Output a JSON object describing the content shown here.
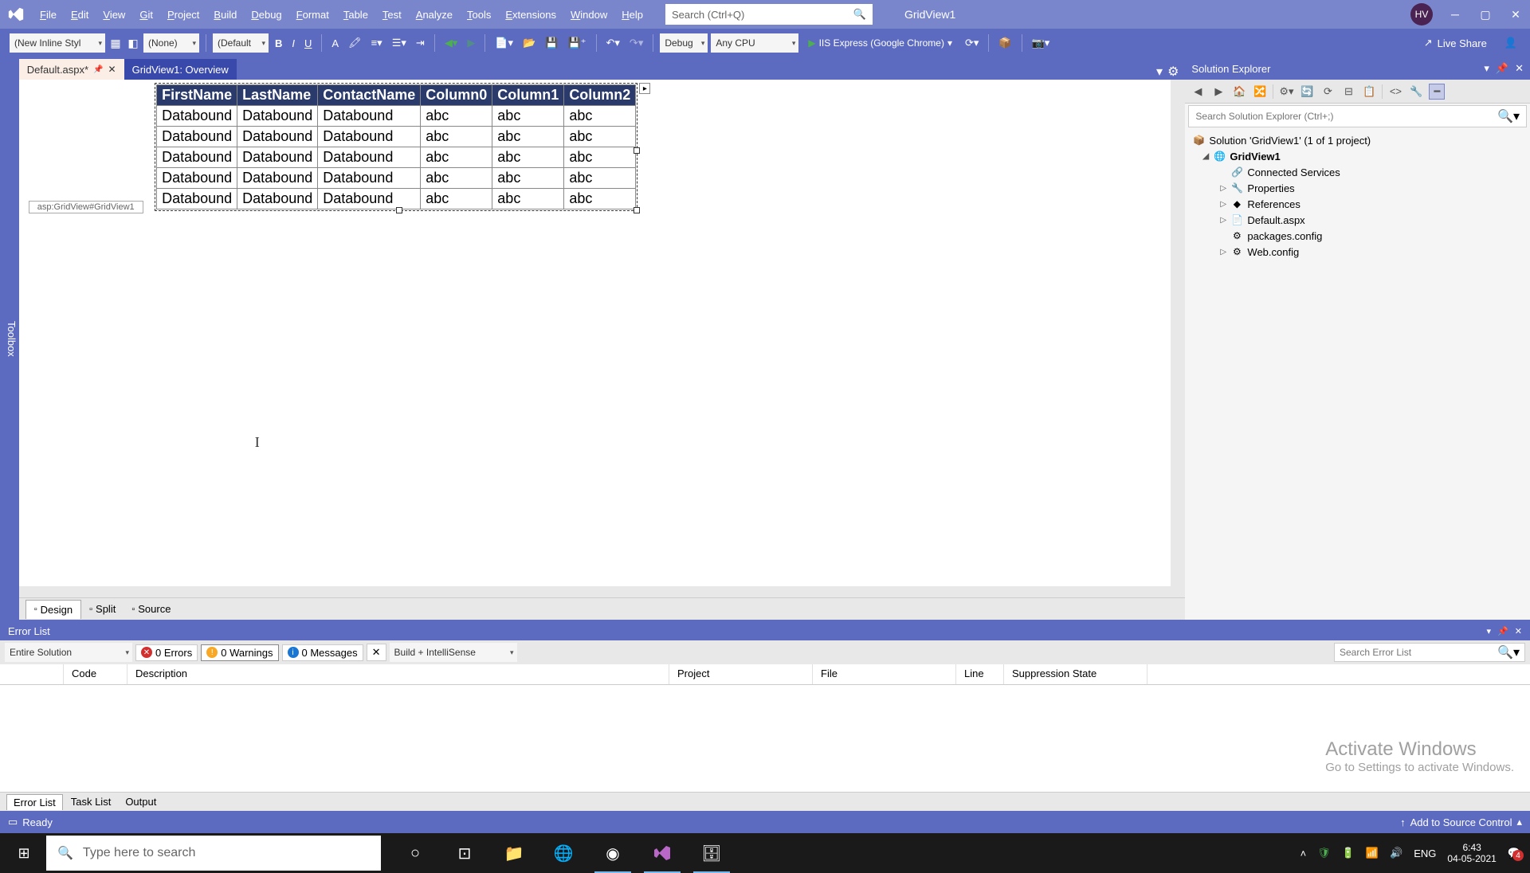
{
  "titlebar": {
    "menus": [
      "File",
      "Edit",
      "View",
      "Git",
      "Project",
      "Build",
      "Debug",
      "Format",
      "Table",
      "Test",
      "Analyze",
      "Tools",
      "Extensions",
      "Window",
      "Help"
    ],
    "search_placeholder": "Search (Ctrl+Q)",
    "solution_name": "GridView1",
    "avatar": "HV"
  },
  "toolbar": {
    "style_rule": "(New Inline Styl",
    "target_rule": "(None)",
    "default_combo": "(Default",
    "config": "Debug",
    "platform": "Any CPU",
    "iis": "IIS Express (Google Chrome)",
    "live_share": "Live Share"
  },
  "tabs": [
    {
      "label": "Default.aspx*",
      "active": true
    },
    {
      "label": "GridView1: Overview",
      "active": false
    }
  ],
  "breadcrumb": "asp:GridView#GridView1",
  "grid": {
    "headers": [
      "FirstName",
      "LastName",
      "ContactName",
      "Column0",
      "Column1",
      "Column2"
    ],
    "rows": [
      [
        "Databound",
        "Databound",
        "Databound",
        "abc",
        "abc",
        "abc"
      ],
      [
        "Databound",
        "Databound",
        "Databound",
        "abc",
        "abc",
        "abc"
      ],
      [
        "Databound",
        "Databound",
        "Databound",
        "abc",
        "abc",
        "abc"
      ],
      [
        "Databound",
        "Databound",
        "Databound",
        "abc",
        "abc",
        "abc"
      ],
      [
        "Databound",
        "Databound",
        "Databound",
        "abc",
        "abc",
        "abc"
      ]
    ]
  },
  "view_tabs": [
    "Design",
    "Split",
    "Source"
  ],
  "solution_explorer": {
    "title": "Solution Explorer",
    "search_placeholder": "Search Solution Explorer (Ctrl+;)",
    "root": "Solution 'GridView1' (1 of 1 project)",
    "project": "GridView1",
    "items": [
      "Connected Services",
      "Properties",
      "References",
      "Default.aspx",
      "packages.config",
      "Web.config"
    ]
  },
  "error_list": {
    "title": "Error List",
    "scope": "Entire Solution",
    "errors": "0 Errors",
    "warnings": "0 Warnings",
    "messages": "0 Messages",
    "build_combo": "Build + IntelliSense",
    "search_placeholder": "Search Error List",
    "columns": [
      "",
      "Code",
      "Description",
      "Project",
      "File",
      "Line",
      "Suppression State"
    ],
    "tabs": [
      "Error List",
      "Task List",
      "Output"
    ]
  },
  "statusbar": {
    "status": "Ready",
    "source_control": "Add to Source Control"
  },
  "activate": {
    "line1": "Activate Windows",
    "line2": "Go to Settings to activate Windows."
  },
  "taskbar": {
    "search_placeholder": "Type here to search",
    "lang": "ENG",
    "time": "6:43",
    "date": "04-05-2021"
  }
}
